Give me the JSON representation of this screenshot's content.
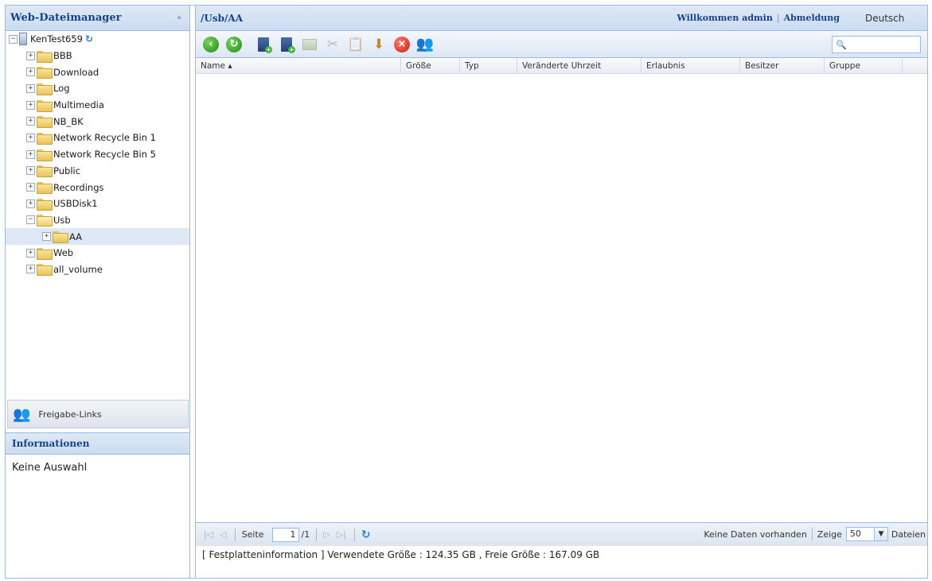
{
  "left_panel": {
    "title": "Web-Dateimanager",
    "collapse_icon": "«"
  },
  "tree": {
    "root": "KenTest659",
    "items": [
      {
        "label": "BBB",
        "level": 1,
        "toggle": "+"
      },
      {
        "label": "Download",
        "level": 1,
        "toggle": "+"
      },
      {
        "label": "Log",
        "level": 1,
        "toggle": "+"
      },
      {
        "label": "Multimedia",
        "level": 1,
        "toggle": "+"
      },
      {
        "label": "NB_BK",
        "level": 1,
        "toggle": "+"
      },
      {
        "label": "Network Recycle Bin 1",
        "level": 1,
        "toggle": "+"
      },
      {
        "label": "Network Recycle Bin 5",
        "level": 1,
        "toggle": "+"
      },
      {
        "label": "Public",
        "level": 1,
        "toggle": "+"
      },
      {
        "label": "Recordings",
        "level": 1,
        "toggle": "+"
      },
      {
        "label": "USBDisk1",
        "level": 1,
        "toggle": "+"
      },
      {
        "label": "Usb",
        "level": 1,
        "toggle": "−"
      },
      {
        "label": "AA",
        "level": 2,
        "toggle": "+"
      },
      {
        "label": "Web",
        "level": 1,
        "toggle": "+"
      },
      {
        "label": "all_volume",
        "level": 1,
        "toggle": "+"
      }
    ]
  },
  "share_links": {
    "label": "Freigabe-Links"
  },
  "info": {
    "title": "Informationen",
    "body": "Keine Auswahl"
  },
  "header": {
    "path": "/Usb/AA",
    "welcome": "Willkommen admin",
    "separator": "|",
    "logout": "Abmeldung",
    "language": "Deutsch"
  },
  "columns": {
    "name": "Name ▴",
    "size": "Größe",
    "type": "Typ",
    "modified": "Veränderte Uhrzeit",
    "permission": "Erlaubnis",
    "owner": "Besitzer",
    "group": "Gruppe"
  },
  "pager": {
    "page_label": "Seite",
    "page_value": "1",
    "page_total": "/1",
    "no_data": "Keine Daten vorhanden",
    "show_label": "Zeige",
    "page_size": "50",
    "files_label": "Dateien"
  },
  "disk": {
    "text": "[ Festplatteninformation ] Verwendete Größe : 124.35 GB , Freie Größe : 167.09 GB"
  },
  "colors": {
    "header_blue": "#15428b",
    "border_blue": "#99bbe8",
    "selected_row": "#dfe8f6"
  }
}
